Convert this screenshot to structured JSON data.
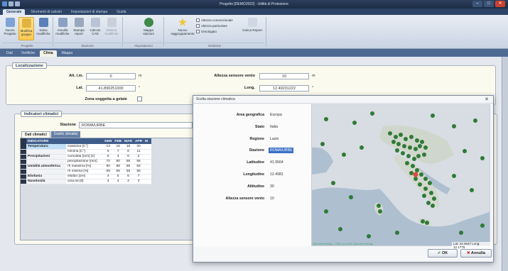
{
  "window": {
    "title": "Progetto [DEMO2022] - Utilità di Protezione"
  },
  "ribbon": {
    "tabs": [
      "Generale",
      "Strumenti di calcolo",
      "Impostazioni di stampa",
      "Guida"
    ],
    "buttons": [
      {
        "label": "Nuovo Progetto",
        "icon": "new-project-icon",
        "color": "#7fa3d6"
      },
      {
        "label": "Modifica gruppo",
        "icon": "edit-group-icon",
        "color": "#e3b341"
      },
      {
        "label": "Salva modifiche",
        "icon": "save-icon",
        "color": "#5b7fb7"
      },
      {
        "label": "Annulla modifiche",
        "icon": "undo-icon",
        "color": "#8aa1c4"
      },
      {
        "label": "Stampa report",
        "icon": "print-icon",
        "color": "#9aa8bd"
      },
      {
        "label": "Calcolo CAD",
        "icon": "calc-icon",
        "color": "#b8c4d6"
      },
      {
        "label": "Elimina modifiche",
        "icon": "delete-icon",
        "color": "#c9d0da"
      },
      {
        "label": "Mappa stazioni",
        "icon": "globe-icon",
        "color": "#3f8a4a"
      },
      {
        "label": "Nuovo raggruppamento",
        "icon": "star-icon",
        "color": "#f0c53a"
      },
      {
        "label": "Carica Report",
        "icon": "report-icon",
        "color": "#cfd7e3"
      }
    ],
    "checks": [
      "Altezza convenzionale",
      "Altezza particolare",
      "Omologato"
    ],
    "groups": [
      "Progetto",
      "Stazione",
      "Impostazioni",
      "Gestione"
    ]
  },
  "view_tabs": [
    "Dati",
    "Verifiche",
    "Clima",
    "Mappa"
  ],
  "localizzazione": {
    "title": "Localizzazione",
    "alt_label": "Alt. l.m.",
    "alt_value": "0",
    "alt_unit": "m",
    "lat_label": "Lat.",
    "lat_value": "41.890251000",
    "lat_unit": "°",
    "altezza_label": "Altezza sensore vento",
    "altezza_value": "10",
    "altezza_unit": "m",
    "long_label": "Long.",
    "long_value": "12.49231222",
    "long_unit": "°",
    "zona_label": "Zona soggetta a gelate"
  },
  "indicatori": {
    "title": "Indicatori climatici",
    "stazione_label": "Stazione",
    "stazione_value": "ROMA/URBE",
    "subtabs": [
      "Dati climatici",
      "Grafici climatici"
    ],
    "columns": [
      "INDICATORE",
      "",
      "GEN",
      "FEB",
      "MAR",
      "APR",
      "M"
    ],
    "rows": [
      {
        "cat": "Temperatura",
        "sub": "massima [C°]",
        "v": [
          "13",
          "15",
          "18",
          "20"
        ]
      },
      {
        "cat": "",
        "sub": "minima [C°]",
        "v": [
          "5",
          "7",
          "8",
          "11"
        ]
      },
      {
        "cat": "Precipitazioni",
        "sub": "cumulata [mm] [1]",
        "v": [
          "5",
          "4",
          "6",
          "2"
        ]
      },
      {
        "cat": "",
        "sub": "precipitazione [mm]",
        "v": [
          "70",
          "80",
          "66",
          "56"
        ]
      },
      {
        "cat": "Umidità atmosferica",
        "sub": "rh massima [%]",
        "v": [
          "90",
          "88",
          "86",
          "83"
        ]
      },
      {
        "cat": "",
        "sub": "rh minima [%]",
        "v": [
          "59",
          "56",
          "56",
          "56"
        ]
      },
      {
        "cat": "Eliofania",
        "sub": "eliofan [ore]",
        "v": [
          "4",
          "5",
          "6",
          "7"
        ]
      },
      {
        "cat": "Nuvolosità",
        "sub": "octa.tot [8]",
        "v": [
          "4",
          "4",
          "3",
          "3"
        ]
      }
    ]
  },
  "dialog": {
    "title": "Scelta stazione climatica",
    "area_label": "Area geografica",
    "area_value": "Europa",
    "stato_label": "Stato",
    "stato_value": "Italia",
    "regione_label": "Regione",
    "regione_value": "Lazio",
    "stazione_label": "Stazione",
    "stazione_value": "ROMA/URBE",
    "lat_label": "Latitudine",
    "lat_value": "41.9564",
    "long_label": "Longitudine",
    "long_value": "12.4981",
    "alt_label": "Altitudine",
    "alt_value": "30",
    "altezza_label": "Altezza sensore vento",
    "altezza_value": "10",
    "coord_text": "Lat: 42.4647 Long: 12.1775",
    "attribution": "OpenStreetMap - Tiles (c) 2022 OpenStreetMap",
    "ok_label": "OK",
    "cancel_label": "Annulla"
  },
  "colors": {
    "accent": "#3f5d8b",
    "selected": "#3a70c6",
    "marker": "#2f7a36"
  }
}
